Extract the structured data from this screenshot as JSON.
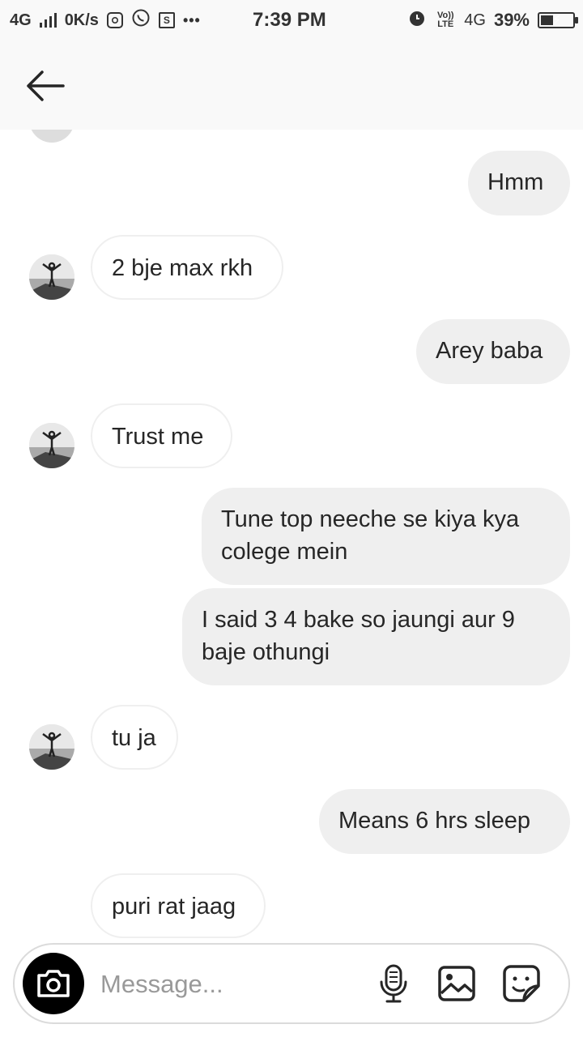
{
  "status_bar": {
    "network": "4G",
    "speed": "0K/s",
    "more": "•••",
    "time": "7:39 PM",
    "volte": "Vo)) LTE",
    "network_right": "4G",
    "battery": "39%"
  },
  "header": {
    "back_icon": "arrow-left-icon"
  },
  "messages": [
    {
      "direction": "out",
      "text": "Hmm"
    },
    {
      "direction": "in",
      "text": "2 bje max rkh"
    },
    {
      "direction": "out",
      "text": "Arey baba"
    },
    {
      "direction": "in",
      "text": "Trust me"
    },
    {
      "direction": "out",
      "text": "Tune top neeche se kiya kya\ncolege mein"
    },
    {
      "direction": "out",
      "text": "I said 3 4 bake so jaungi aur 9\nbaje othungi"
    },
    {
      "direction": "in",
      "text": "tu ja"
    },
    {
      "direction": "out",
      "text": "Means 6 hrs sleep"
    },
    {
      "direction": "in",
      "text": "puri rat jaag"
    }
  ],
  "composer": {
    "placeholder": "Message...",
    "camera_icon": "camera-icon",
    "mic_icon": "microphone-icon",
    "gallery_icon": "image-icon",
    "sticker_icon": "sticker-icon"
  },
  "colors": {
    "outgoing_bubble": "#efefef",
    "incoming_border": "#efefef",
    "header_bg": "#f9f9f9",
    "text": "#262626"
  }
}
